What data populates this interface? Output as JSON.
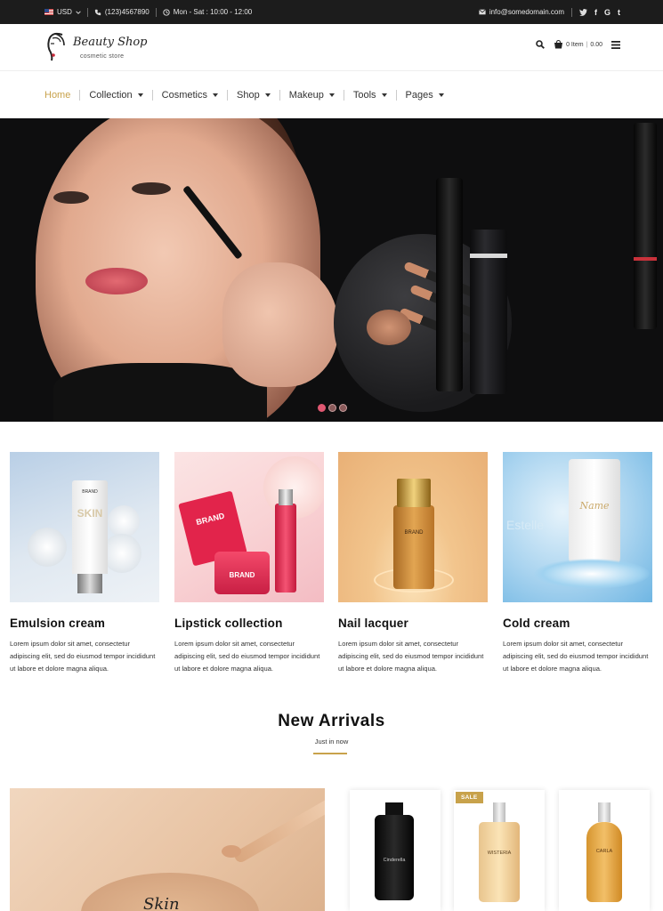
{
  "topbar": {
    "currency": "USD",
    "phone": "(123)4567890",
    "hours": "Mon - Sat : 10:00 - 12:00",
    "email": "info@somedomain.com",
    "social": [
      "twitter-icon",
      "facebook-icon",
      "google-icon",
      "tumblr-icon"
    ]
  },
  "logo": {
    "title": "Beauty Shop",
    "subtitle": "cosmetic store"
  },
  "header": {
    "cart_items": "0 Item",
    "cart_total": "0.00"
  },
  "nav": {
    "items": [
      {
        "label": "Home",
        "active": true
      },
      {
        "label": "Collection"
      },
      {
        "label": "Cosmetics"
      },
      {
        "label": "Shop"
      },
      {
        "label": "Makeup"
      },
      {
        "label": "Tools"
      },
      {
        "label": "Pages"
      }
    ]
  },
  "hero": {
    "slides": 3,
    "active_slide": 1
  },
  "categories": [
    {
      "title": "Emulsion cream",
      "desc": "Lorem ipsum dolor sit amet, consectetur adipiscing elit, sed do eiusmod tempor incididunt ut labore et dolore magna aliqua.",
      "brand": "BRAND",
      "label": "SKIN"
    },
    {
      "title": "Lipstick collection",
      "desc": "Lorem ipsum dolor sit amet, consectetur adipiscing elit, sed do eiusmod tempor incididunt ut labore et dolore magna aliqua.",
      "brand": "BRAND"
    },
    {
      "title": "Nail lacquer",
      "desc": "Lorem ipsum dolor sit amet, consectetur adipiscing elit, sed do eiusmod tempor incididunt ut labore et dolore magna aliqua.",
      "brand": "BRAND"
    },
    {
      "title": "Cold cream",
      "desc": "Lorem ipsum dolor sit amet, consectetur adipiscing elit, sed do eiusmod tempor incididunt ut labore et dolore magna aliqua.",
      "brand": "Estelle",
      "label": "Name"
    }
  ],
  "new_arrivals": {
    "title": "New Arrivals",
    "subtitle": "Just in now",
    "promo_text": "Skin",
    "products": [
      {
        "badge": "",
        "label": "Cinderella"
      },
      {
        "badge": "SALE",
        "label": "WISTERIA"
      },
      {
        "badge": "",
        "label": "CARLA"
      }
    ]
  },
  "colors": {
    "accent": "#c8a24b",
    "topbar": "#1c1c1c",
    "slider_active": "#e05872"
  }
}
